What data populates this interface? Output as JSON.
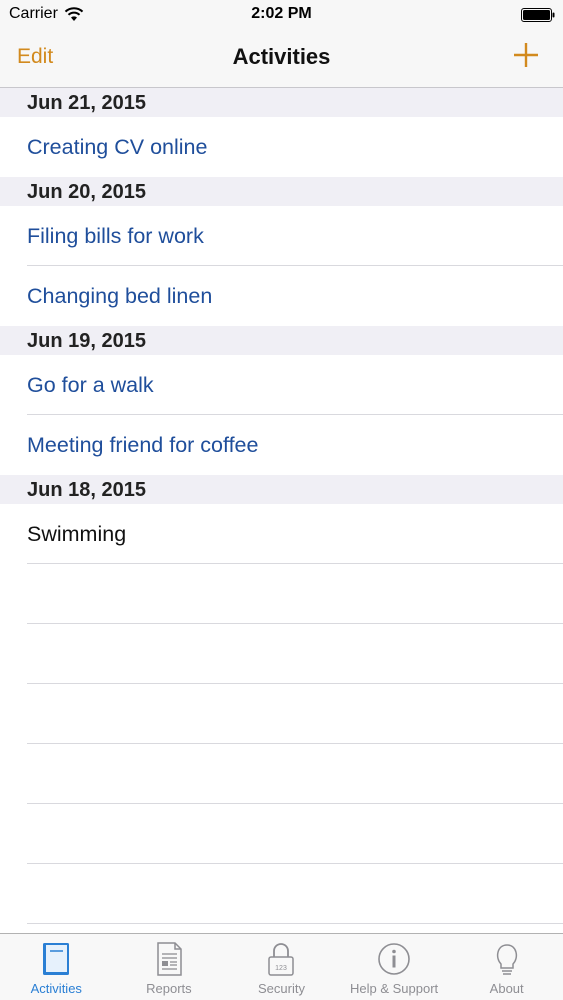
{
  "status_bar": {
    "carrier": "Carrier",
    "time": "2:02 PM"
  },
  "nav": {
    "edit_label": "Edit",
    "title": "Activities",
    "add_icon": "plus-icon"
  },
  "sections": [
    {
      "date": "Jun 21, 2015",
      "items": [
        {
          "label": "Creating CV online",
          "style": "link"
        }
      ]
    },
    {
      "date": "Jun 20, 2015",
      "items": [
        {
          "label": "Filing bills for work",
          "style": "link"
        },
        {
          "label": "Changing bed linen",
          "style": "link"
        }
      ]
    },
    {
      "date": "Jun 19, 2015",
      "items": [
        {
          "label": "Go for a walk",
          "style": "link"
        },
        {
          "label": "Meeting friend for coffee",
          "style": "link"
        }
      ]
    },
    {
      "date": "Jun 18, 2015",
      "items": [
        {
          "label": "Swimming",
          "style": "plain"
        }
      ]
    }
  ],
  "tabs": [
    {
      "label": "Activities",
      "icon": "book-icon",
      "active": true
    },
    {
      "label": "Reports",
      "icon": "document-icon",
      "active": false
    },
    {
      "label": "Security",
      "icon": "lock-icon",
      "active": false
    },
    {
      "label": "Help & Support",
      "icon": "info-icon",
      "active": false
    },
    {
      "label": "About",
      "icon": "lightbulb-icon",
      "active": false
    }
  ],
  "colors": {
    "accent": "#d28a1e",
    "link": "#1f4e9b",
    "tab_active": "#2a7fd4",
    "tab_inactive": "#8e8e93"
  }
}
